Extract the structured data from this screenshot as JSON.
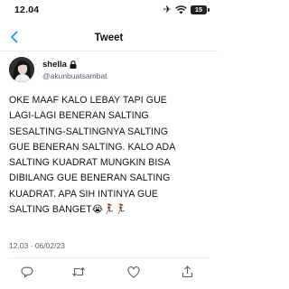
{
  "status_bar": {
    "time": "12.04",
    "battery_level": "15",
    "icons": [
      "airplane-icon",
      "wifi-icon",
      "battery-icon"
    ]
  },
  "nav": {
    "title": "Tweet",
    "back_icon": "chevron-left-icon"
  },
  "author": {
    "display_name": "shella",
    "handle": "@akunbuatsambat",
    "lock_icon": "lock-icon"
  },
  "tweet": {
    "text": "OKE MAAF KALO LEBAY TAPI GUE\nLAGI-LAGI BENERAN SALTING\nSESALTING-SALTINGNYA SALTING\nGUE BENERAN SALTING. KALO ADA\nSALTING KUADRAT MUNGKIN BISA\nDIBILANG GUE BENERAN SALTING\nKUADRAT. APA SIH INTINYA GUE\nSALTING BANGET😭🏃‍♀️🏃‍♀️",
    "timestamp": "12.03 · 06/02/23"
  },
  "actions": [
    "reply-icon",
    "retweet-icon",
    "like-icon",
    "share-icon"
  ],
  "colors": {
    "accent": "#1d9bf0",
    "muted": "#536471",
    "text": "#0f1419",
    "divider": "#e6ecf0"
  }
}
